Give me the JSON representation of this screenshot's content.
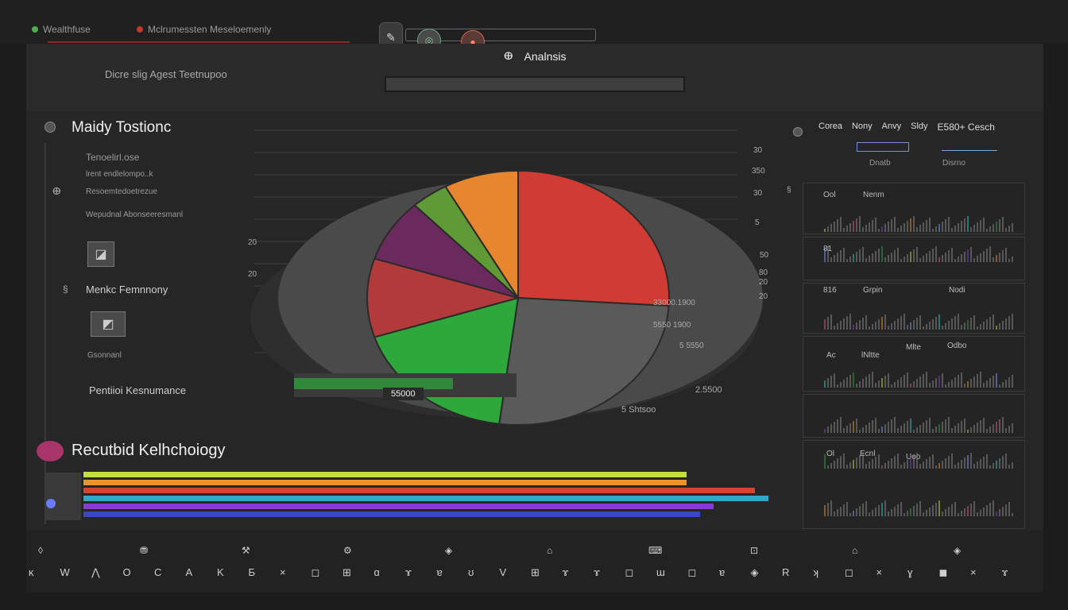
{
  "topbar": {
    "tab1_label": "Wealthfuse",
    "tab2_label": "Mclrumessten Meseloemenly",
    "subtitle": "Dicre slig Agest Teetnupoo",
    "analysis_label": "Analnsis",
    "colors": {
      "accent_green": "#4caf50",
      "accent_red": "#c0392b"
    }
  },
  "sidebar": {
    "title": "Maidy Tostionc",
    "items": [
      "Tenoelirl.ose",
      "lrent endlelompo..k",
      "Resoemtedoetrezue",
      "Wepudnal Abonseeresmanl"
    ],
    "mid_item": "Menkc Femnnony",
    "small_item": "Gsonnanl",
    "perf_label": "Pentiioi Kesnumance",
    "section2_title": "Recutbid Kelhchoiogy"
  },
  "chart_data": {
    "type": "pie",
    "title": "",
    "tick_labels": [
      "30",
      "350",
      "30",
      "5",
      "50",
      "80",
      "20",
      "20",
      "20",
      "20"
    ],
    "annotations": [
      "33000.1900",
      "5550 1900",
      "5 5550",
      "2.5500",
      "55000",
      "5 Shtsoo"
    ],
    "slices": [
      {
        "color": "#d03b34",
        "value": 26
      },
      {
        "color": "#5a5a5a",
        "value": 26
      },
      {
        "color": "#2ea83a",
        "value": 18
      },
      {
        "color": "#b23a3a",
        "value": 10
      },
      {
        "color": "#6b2a5e",
        "value": 8
      },
      {
        "color": "#5f9a36",
        "value": 4
      },
      {
        "color": "#e8852f",
        "value": 8
      }
    ]
  },
  "bars_chart": {
    "type": "bar",
    "series": [
      {
        "color": "#c6e03b",
        "value": 0.88
      },
      {
        "color": "#e8962c",
        "value": 0.88
      },
      {
        "color": "#d9432e",
        "value": 0.98
      },
      {
        "color": "#2fa7c9",
        "value": 1.0
      },
      {
        "color": "#8b3bd1",
        "value": 0.92
      },
      {
        "color": "#3b46c6",
        "value": 0.9
      }
    ]
  },
  "right_panel": {
    "header": [
      "Corea",
      "Nony",
      "Anvy",
      "Sldy",
      "E580+ Cesch"
    ],
    "sub_header": [
      "Dnatb",
      "Disrno"
    ],
    "sections": [
      {
        "label": "Ool",
        "tag": "Nenm"
      },
      {
        "label": "81"
      },
      {
        "label": "816",
        "tag": "Grpin"
      },
      {
        "label": "Nodi"
      },
      {
        "label": "Ac",
        "tag": "lNltte"
      },
      {
        "label": "Mlte",
        "tag": "Odbo"
      },
      {
        "label": "Ol",
        "tag": "Ecnl"
      },
      {
        "label": "Uoo"
      }
    ]
  },
  "toolbar": {
    "icons_row1": [
      "◊",
      "⛃",
      "⚒",
      "⚙",
      "◈",
      "⌂",
      "⌨",
      "⊡",
      "⌂",
      "◈"
    ],
    "icons_row2": [
      "ĸ",
      "W",
      "⋀",
      "O",
      "C",
      "A",
      "K",
      "Ƃ",
      "×",
      "◻",
      "⊞",
      "ɑ",
      "ɤ",
      "ɐ",
      "ʊ",
      "V",
      "⊞",
      "ɤ",
      "ɤ",
      "◻",
      "ɯ",
      "◻",
      "ɐ",
      "◈",
      "R",
      "ʞ",
      "◻",
      "×",
      "ɣ",
      "◼",
      "×",
      "ɤ"
    ]
  }
}
